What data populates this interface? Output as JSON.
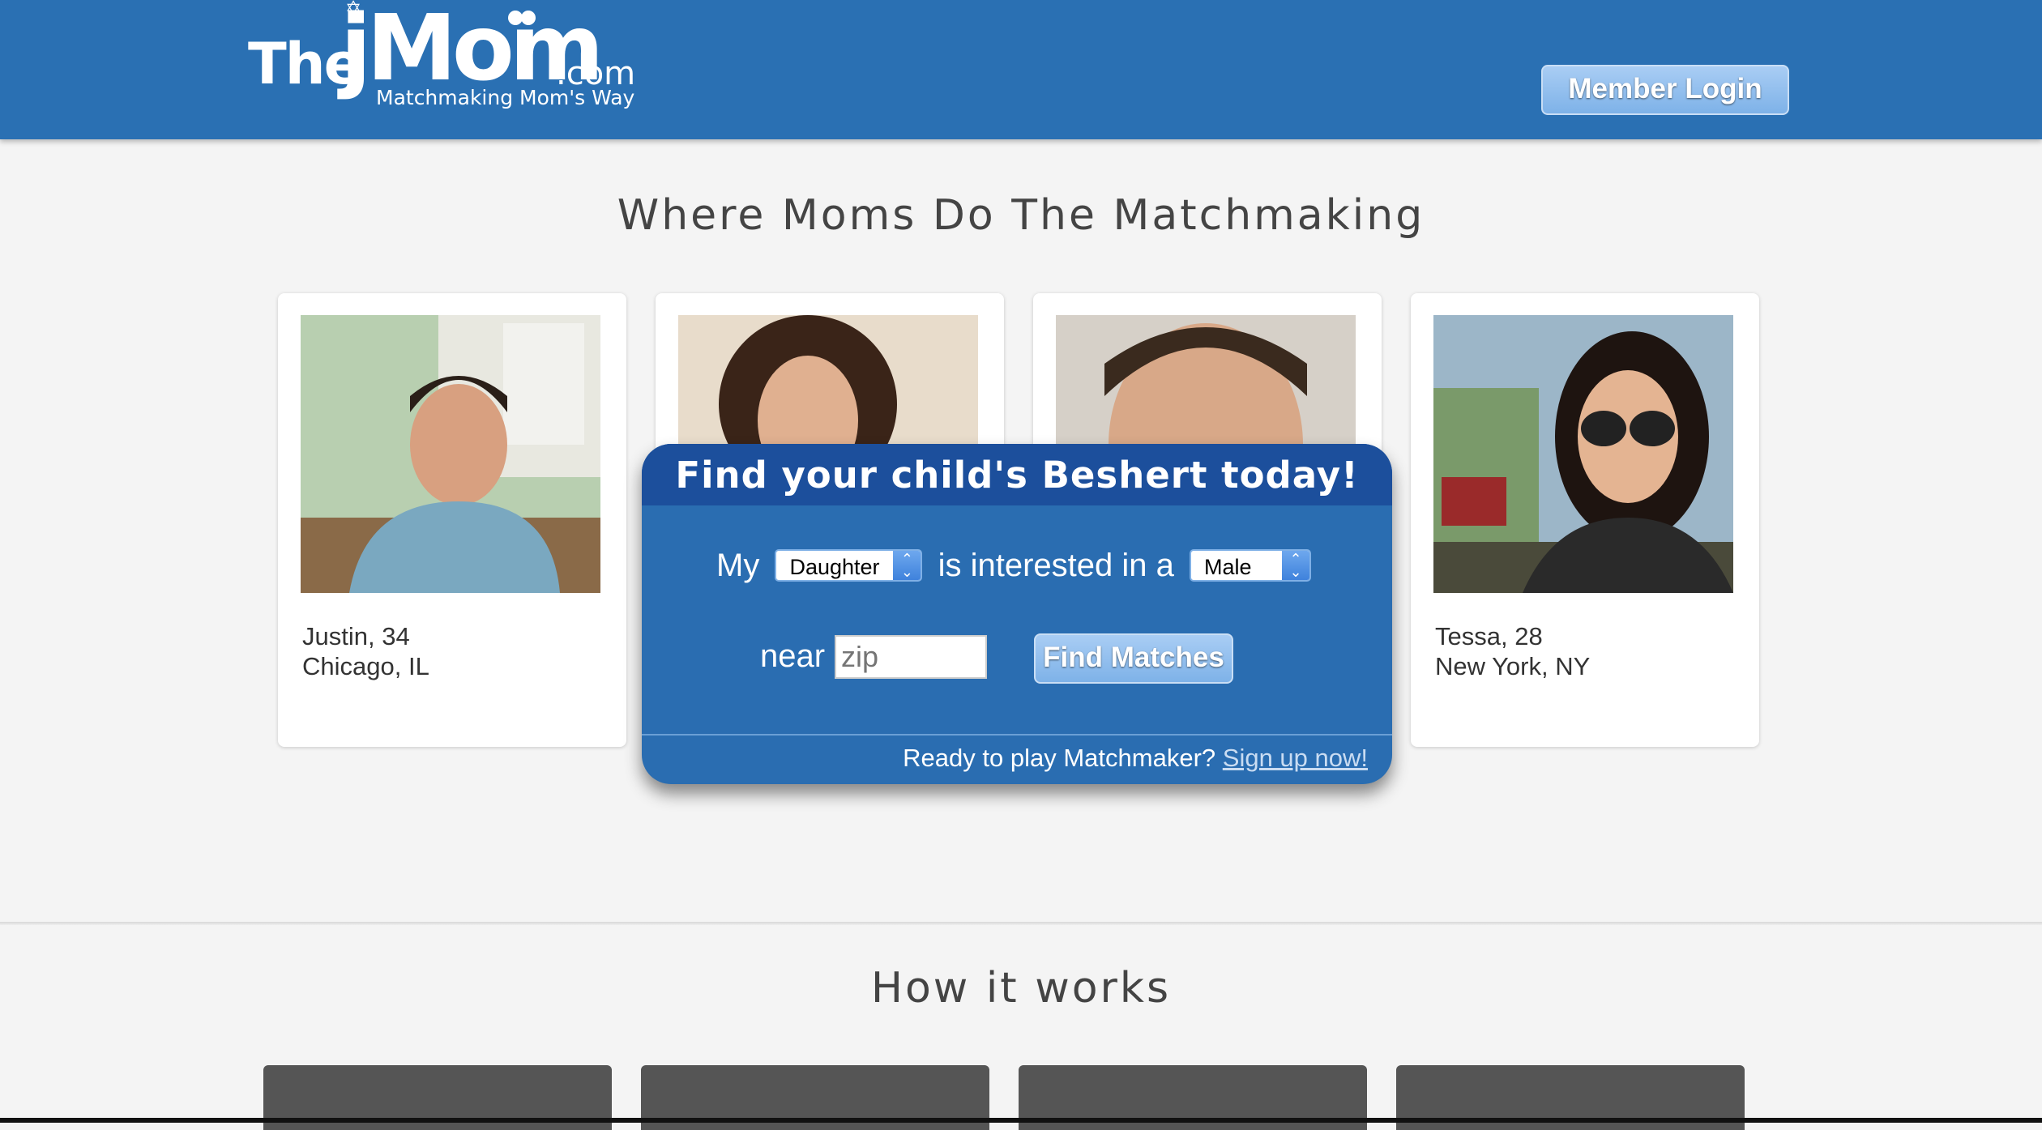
{
  "header": {
    "logo": {
      "the": "The",
      "jmom": "jMom",
      "dotcom": ".com",
      "tagline": "Matchmaking Mom's Way"
    },
    "member_login_label": "Member Login",
    "colors": {
      "header_bg": "#2a70b3",
      "button_bg": "#8fbdec"
    }
  },
  "hero": {
    "title": "Where Moms Do The Matchmaking"
  },
  "profiles": [
    {
      "name_age": "Justin, 34",
      "location": "Chicago, IL"
    },
    {
      "name_age": "",
      "location": ""
    },
    {
      "name_age": "",
      "location": ""
    },
    {
      "name_age": "Tessa, 28",
      "location": "New York, NY"
    }
  ],
  "search": {
    "title": "Find your child's Beshert today!",
    "my_label": "My",
    "child_selected": "Daughter",
    "interested_label": "is interested in a",
    "gender_selected": "Male",
    "near_label": "near",
    "zip_placeholder": "zip",
    "find_label": "Find Matches",
    "footer_text": "Ready to play Matchmaker?",
    "signup_link": "Sign up now!"
  },
  "how": {
    "title": "How it works"
  }
}
